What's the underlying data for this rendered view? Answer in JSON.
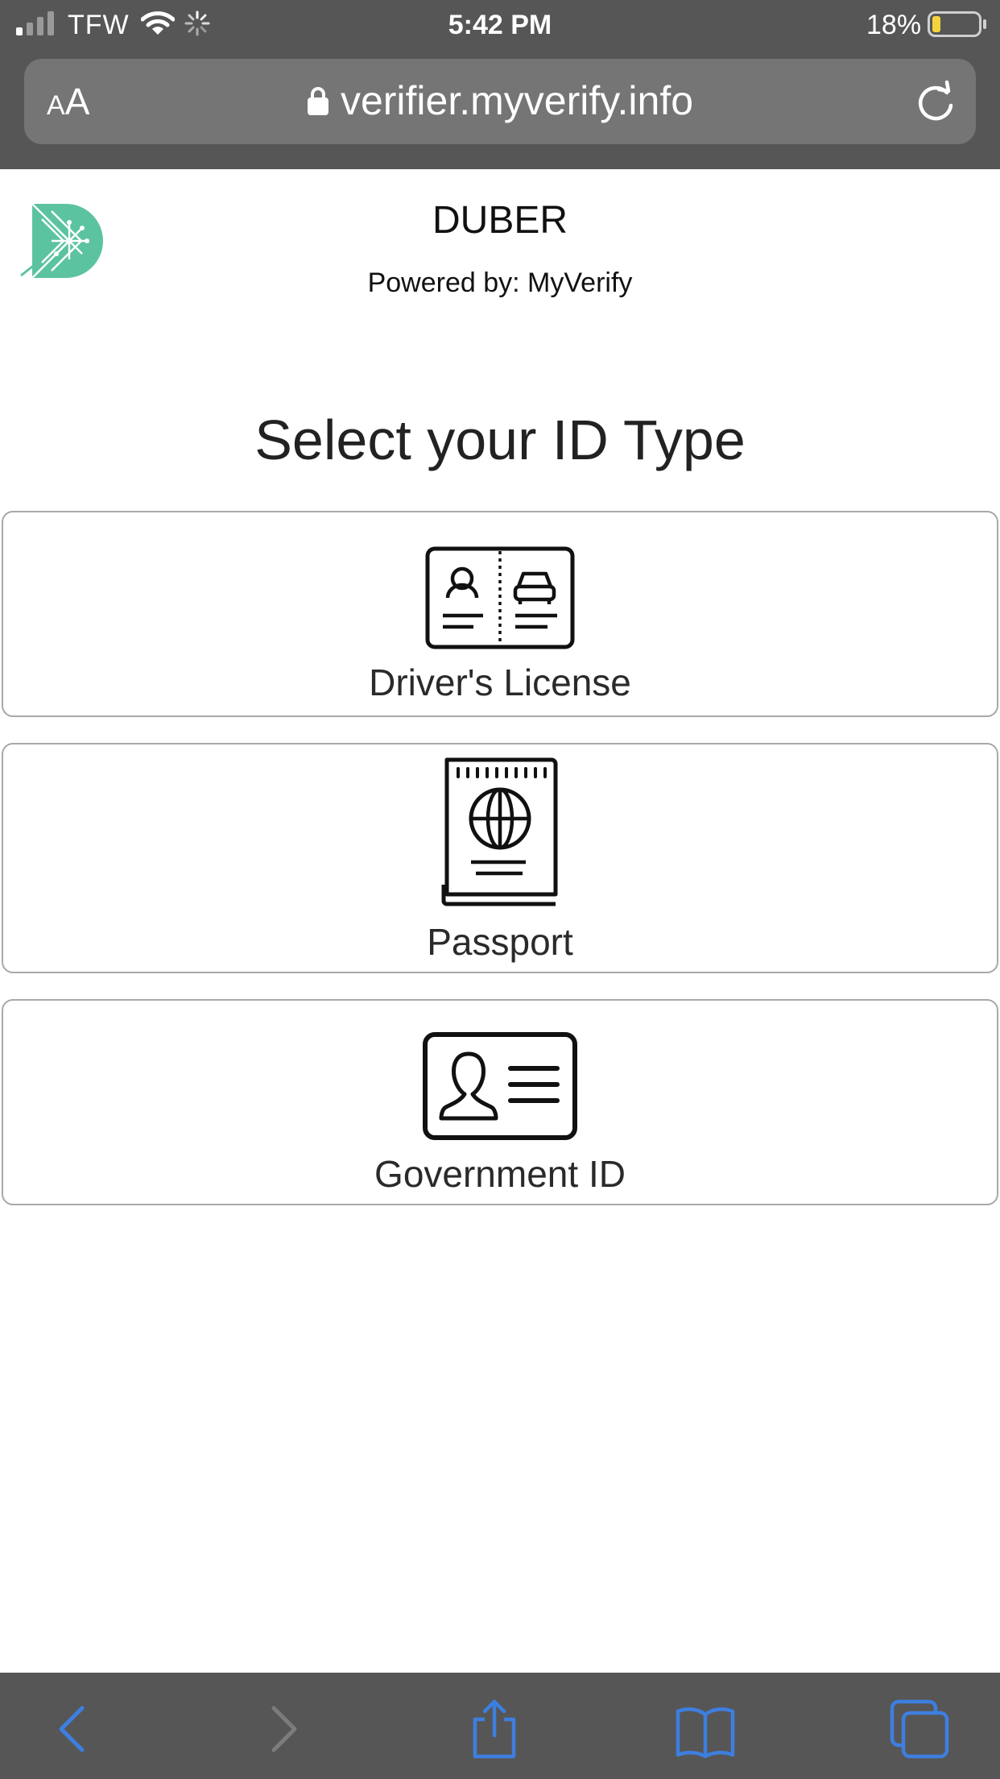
{
  "status_bar": {
    "carrier": "TFW",
    "time": "5:42 PM",
    "battery_percent": "18%",
    "battery_level": 0.18,
    "battery_color": "#f5d33c"
  },
  "browser": {
    "text_size_label_small": "A",
    "text_size_label_large": "A",
    "url": "verifier.myverify.info"
  },
  "header": {
    "brand": "DUBER",
    "powered_by": "Powered by: MyVerify",
    "logo_color": "#5cc3a1"
  },
  "main": {
    "heading": "Select your ID Type",
    "options": [
      {
        "label": "Driver's License",
        "icon": "drivers-license-icon"
      },
      {
        "label": "Passport",
        "icon": "passport-icon"
      },
      {
        "label": "Government ID",
        "icon": "government-id-icon"
      }
    ]
  },
  "toolbar": {
    "accent_color": "#3d7fe0",
    "disabled_color": "#7c7c7c",
    "items": [
      "back-icon",
      "forward-icon",
      "share-icon",
      "bookmarks-icon",
      "tabs-icon"
    ]
  }
}
